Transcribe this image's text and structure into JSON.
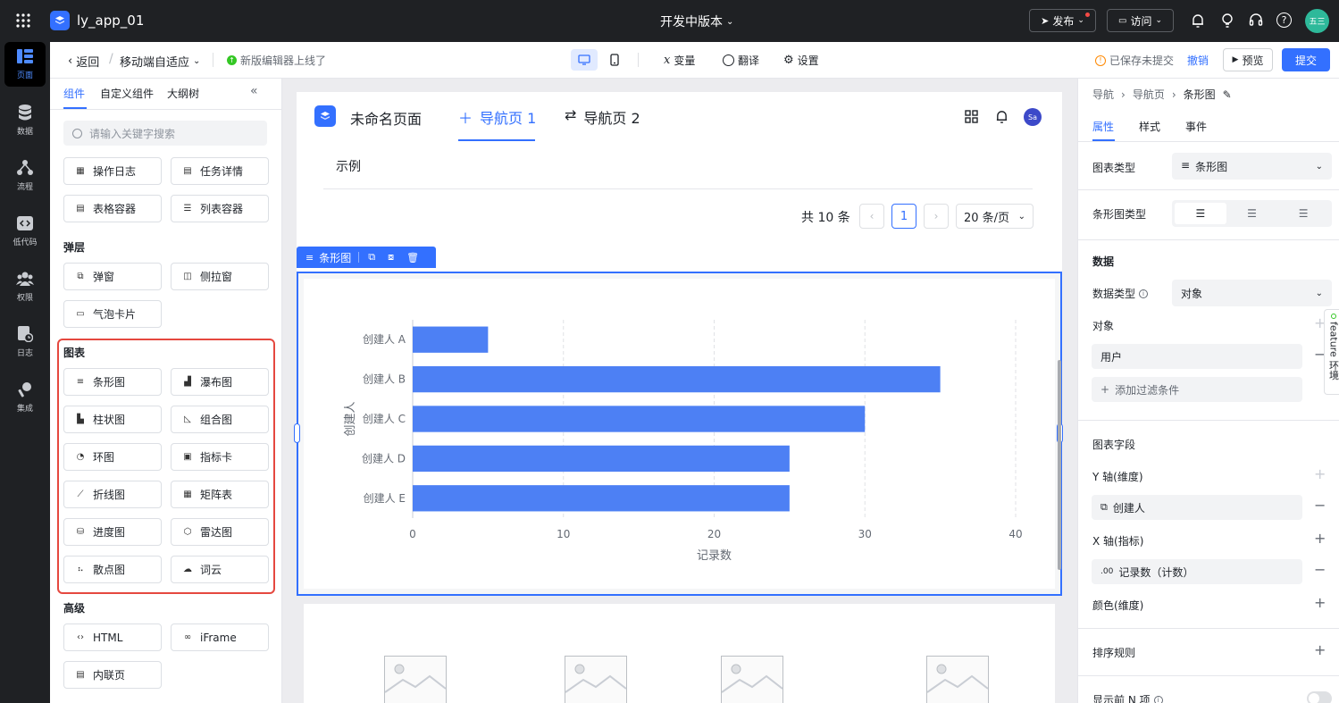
{
  "topbar": {
    "app_name": "ly_app_01",
    "version_label": "开发中版本",
    "publish_label": "发布",
    "visit_label": "访问",
    "avatar_text": "五三"
  },
  "leftnav": {
    "items": [
      {
        "label": "页面",
        "icon": "page-icon"
      },
      {
        "label": "数据",
        "icon": "database-icon"
      },
      {
        "label": "流程",
        "icon": "flow-icon"
      },
      {
        "label": "低代码",
        "icon": "code-icon"
      },
      {
        "label": "权限",
        "icon": "users-icon"
      },
      {
        "label": "日志",
        "icon": "log-icon"
      },
      {
        "label": "集成",
        "icon": "integration-icon"
      }
    ]
  },
  "toolbar2": {
    "back_label": "返回",
    "page_mode": "移动端自适应",
    "notice": "新版编辑器上线了",
    "var_label": "变量",
    "translate_label": "翻译",
    "settings_label": "设置",
    "saved_status": "已保存未提交",
    "undo_label": "撤销",
    "preview_label": "预览",
    "submit_label": "提交"
  },
  "leftpanel": {
    "tabs": [
      "组件",
      "自定义组件",
      "大纲树"
    ],
    "search_placeholder": "请输入关键字搜索",
    "row_a": [
      "操作日志",
      "任务详情"
    ],
    "row_b": [
      "表格容器",
      "列表容器"
    ],
    "layer_title": "弹层",
    "layer_items": [
      "弹窗",
      "侧拉窗",
      "气泡卡片"
    ],
    "chart_title": "图表",
    "chart_items": [
      "条形图",
      "瀑布图",
      "柱状图",
      "组合图",
      "环图",
      "指标卡",
      "折线图",
      "矩阵表",
      "进度图",
      "雷达图",
      "散点图",
      "词云"
    ],
    "advanced_title": "高级",
    "advanced_items": [
      "HTML",
      "iFrame",
      "内联页"
    ],
    "highlight_color": "#e5483f"
  },
  "canvas": {
    "page_title": "未命名页面",
    "nav1": "导航页 1",
    "nav2": "导航页 2",
    "user_avatar": "Sa",
    "example_label": "示例",
    "total_text": "共 10 条",
    "current_page": "1",
    "page_size": "20 条/页",
    "selected_tag": "条形图"
  },
  "chart_data": {
    "type": "bar",
    "orientation": "horizontal",
    "categories": [
      "创建人 A",
      "创建人 B",
      "创建人 C",
      "创建人 D",
      "创建人 E"
    ],
    "values": [
      5,
      35,
      30,
      25,
      25
    ],
    "xlabel": "记录数",
    "ylabel": "创建人",
    "xlim": [
      0,
      40
    ],
    "xticks": [
      "0",
      "10",
      "20",
      "30",
      "40"
    ],
    "grid": "vertical-dashed",
    "color": "#4d80f4"
  },
  "rightpanel": {
    "breadcrumb": [
      "导航",
      "导航页",
      "条形图"
    ],
    "tabs": [
      "属性",
      "样式",
      "事件"
    ],
    "chart_type_label": "图表类型",
    "chart_type_value": "条形图",
    "bar_type_label": "条形图类型",
    "data_section": "数据",
    "data_type_label": "数据类型",
    "data_type_value": "对象",
    "object_label": "对象",
    "object_value": "用户",
    "add_filter": "添加过滤条件",
    "fields_section": "图表字段",
    "y_axis_label": "Y 轴(维度)",
    "y_axis_value": "创建人",
    "x_axis_label": "X 轴(指标)",
    "x_axis_value": "记录数（计数）",
    "x_axis_prefix": ".00",
    "color_label": "颜色(维度)",
    "sort_label": "排序规则",
    "topn_label": "显示前 N 项",
    "feature_tab": "feature 环境"
  },
  "colors": {
    "accent": "#3370ff",
    "dark_bg": "#1f2124",
    "bar": "#4d80f4"
  }
}
